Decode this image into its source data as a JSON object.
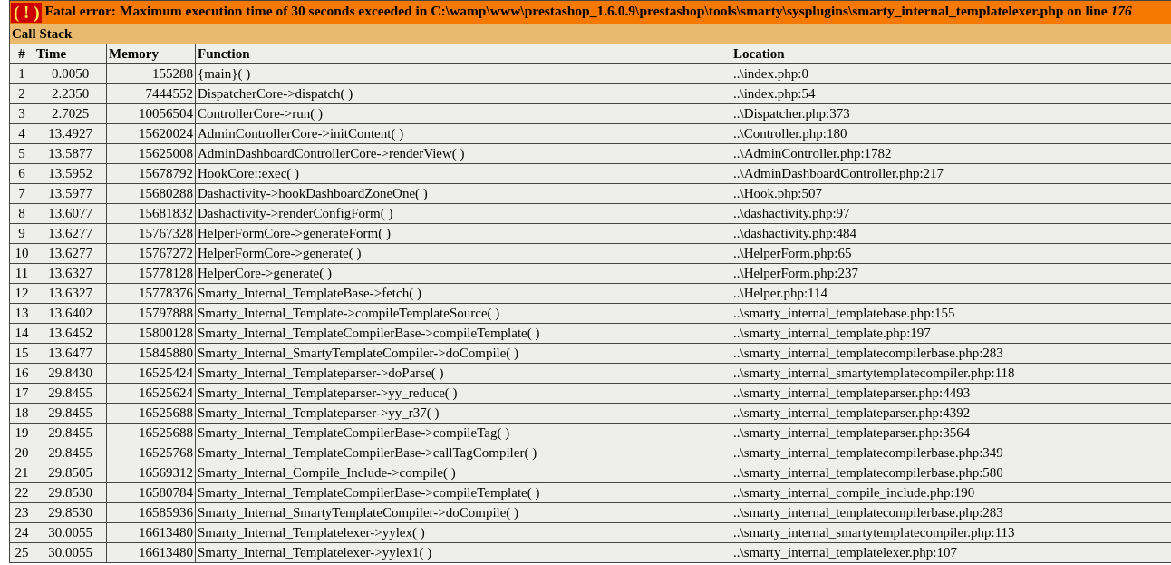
{
  "error": {
    "icon": "( ! )",
    "message": "Fatal error: Maximum execution time of 30 seconds exceeded in C:\\wamp\\www\\prestashop_1.6.0.9\\prestashop\\tools\\smarty\\sysplugins\\smarty_internal_templatelexer.php on line *176*"
  },
  "call_stack": {
    "title": "Call Stack",
    "columns": [
      "#",
      "Time",
      "Memory",
      "Function",
      "Location"
    ],
    "rows": [
      [
        "1",
        "0.0050",
        "155288",
        "{main}( )",
        "..\\index.php:0"
      ],
      [
        "2",
        "2.2350",
        "7444552",
        "DispatcherCore->dispatch( )",
        "..\\index.php:54"
      ],
      [
        "3",
        "2.7025",
        "10056504",
        "ControllerCore->run( )",
        "..\\Dispatcher.php:373"
      ],
      [
        "4",
        "13.4927",
        "15620024",
        "AdminControllerCore->initContent( )",
        "..\\Controller.php:180"
      ],
      [
        "5",
        "13.5877",
        "15625008",
        "AdminDashboardControllerCore->renderView( )",
        "..\\AdminController.php:1782"
      ],
      [
        "6",
        "13.5952",
        "15678792",
        "HookCore::exec( )",
        "..\\AdminDashboardController.php:217"
      ],
      [
        "7",
        "13.5977",
        "15680288",
        "Dashactivity->hookDashboardZoneOne( )",
        "..\\Hook.php:507"
      ],
      [
        "8",
        "13.6077",
        "15681832",
        "Dashactivity->renderConfigForm( )",
        "..\\dashactivity.php:97"
      ],
      [
        "9",
        "13.6277",
        "15767328",
        "HelperFormCore->generateForm( )",
        "..\\dashactivity.php:484"
      ],
      [
        "10",
        "13.6277",
        "15767272",
        "HelperFormCore->generate( )",
        "..\\HelperForm.php:65"
      ],
      [
        "11",
        "13.6327",
        "15778128",
        "HelperCore->generate( )",
        "..\\HelperForm.php:237"
      ],
      [
        "12",
        "13.6327",
        "15778376",
        "Smarty_Internal_TemplateBase->fetch( )",
        "..\\Helper.php:114"
      ],
      [
        "13",
        "13.6402",
        "15797888",
        "Smarty_Internal_Template->compileTemplateSource( )",
        "..\\smarty_internal_templatebase.php:155"
      ],
      [
        "14",
        "13.6452",
        "15800128",
        "Smarty_Internal_TemplateCompilerBase->compileTemplate( )",
        "..\\smarty_internal_template.php:197"
      ],
      [
        "15",
        "13.6477",
        "15845880",
        "Smarty_Internal_SmartyTemplateCompiler->doCompile( )",
        "..\\smarty_internal_templatecompilerbase.php:283"
      ],
      [
        "16",
        "29.8430",
        "16525424",
        "Smarty_Internal_Templateparser->doParse( )",
        "..\\smarty_internal_smartytemplatecompiler.php:118"
      ],
      [
        "17",
        "29.8455",
        "16525624",
        "Smarty_Internal_Templateparser->yy_reduce( )",
        "..\\smarty_internal_templateparser.php:4493"
      ],
      [
        "18",
        "29.8455",
        "16525688",
        "Smarty_Internal_Templateparser->yy_r37( )",
        "..\\smarty_internal_templateparser.php:4392"
      ],
      [
        "19",
        "29.8455",
        "16525688",
        "Smarty_Internal_TemplateCompilerBase->compileTag( )",
        "..\\smarty_internal_templateparser.php:3564"
      ],
      [
        "20",
        "29.8455",
        "16525768",
        "Smarty_Internal_TemplateCompilerBase->callTagCompiler( )",
        "..\\smarty_internal_templatecompilerbase.php:349"
      ],
      [
        "21",
        "29.8505",
        "16569312",
        "Smarty_Internal_Compile_Include->compile( )",
        "..\\smarty_internal_templatecompilerbase.php:580"
      ],
      [
        "22",
        "29.8530",
        "16580784",
        "Smarty_Internal_TemplateCompilerBase->compileTemplate( )",
        "..\\smarty_internal_compile_include.php:190"
      ],
      [
        "23",
        "29.8530",
        "16585936",
        "Smarty_Internal_SmartyTemplateCompiler->doCompile( )",
        "..\\smarty_internal_templatecompilerbase.php:283"
      ],
      [
        "24",
        "30.0055",
        "16613480",
        "Smarty_Internal_Templatelexer->yylex( )",
        "..\\smarty_internal_smartytemplatecompiler.php:113"
      ],
      [
        "25",
        "30.0055",
        "16613480",
        "Smarty_Internal_Templatelexer->yylex1( )",
        "..\\smarty_internal_templatelexer.php:107"
      ]
    ]
  }
}
